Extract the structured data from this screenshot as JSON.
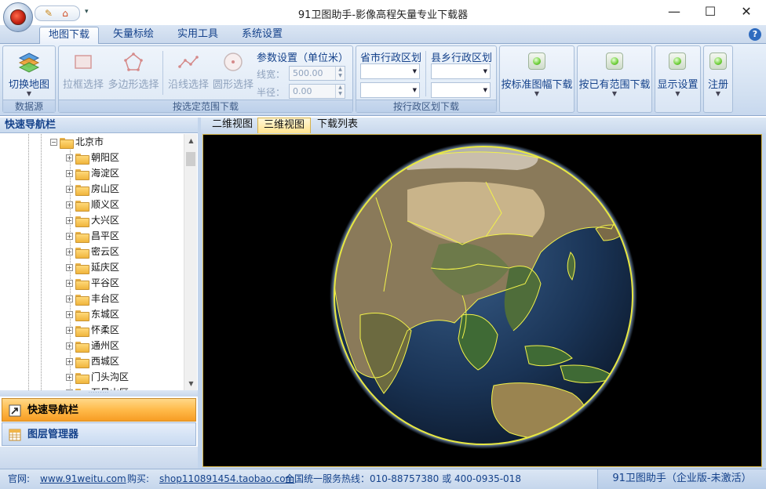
{
  "window": {
    "title": "91卫图助手-影像高程矢量专业下载器",
    "minimize": "—",
    "maximize": "☐",
    "close": "✕"
  },
  "quick_access": {
    "dropdown": "▾"
  },
  "ribbon_tabs": [
    "地图下载",
    "矢量标绘",
    "实用工具",
    "系统设置"
  ],
  "help": "?",
  "ribbon": {
    "datasource_group": {
      "label": "数据源",
      "switch_map": "切换地图"
    },
    "range_group": {
      "label": "按选定范围下载",
      "rect_select": "拉框选择",
      "polygon_select": "多边形选择",
      "line_select": "沿线选择",
      "circle_select": "圆形选择",
      "params_title": "参数设置（单位米）",
      "line_width_label": "线宽：",
      "line_width_value": "500.00",
      "radius_label": "半径：",
      "radius_value": "0.00"
    },
    "admin_group": {
      "label": "按行政区划下载",
      "province_city": "省市行政区划",
      "county_town": "县乡行政区划"
    },
    "standard_sheet": "按标准图幅下载",
    "existing_range": "按已有范围下载",
    "display_settings": "显示设置",
    "register": "注册"
  },
  "nav_panel": {
    "title": "快速导航栏",
    "tree": {
      "root": "北京市",
      "children": [
        "朝阳区",
        "海淀区",
        "房山区",
        "顺义区",
        "大兴区",
        "昌平区",
        "密云区",
        "延庆区",
        "平谷区",
        "丰台区",
        "东城区",
        "怀柔区",
        "通州区",
        "西城区",
        "门头沟区",
        "石景山区"
      ]
    },
    "nav_button": "快速导航栏",
    "layer_button": "图层管理器"
  },
  "view_tabs": [
    "二维视图",
    "三维视图",
    "下载列表"
  ],
  "active_view_tab": "三维视图",
  "status": {
    "website_label": "官网:",
    "website": "www.91weitu.com",
    "buy_label": "购买:",
    "shop": "shop110891454.taobao.com",
    "hotline": "全国统一服务热线：010-88757380 或 400-0935-018",
    "edition": "91卫图助手（企业版-未激活）"
  },
  "colors": {
    "accent": "#15428b",
    "ribbon_bg": "#d2e0f1",
    "border_yellow": "#e8e840",
    "active_orange": "#ffba4a"
  }
}
